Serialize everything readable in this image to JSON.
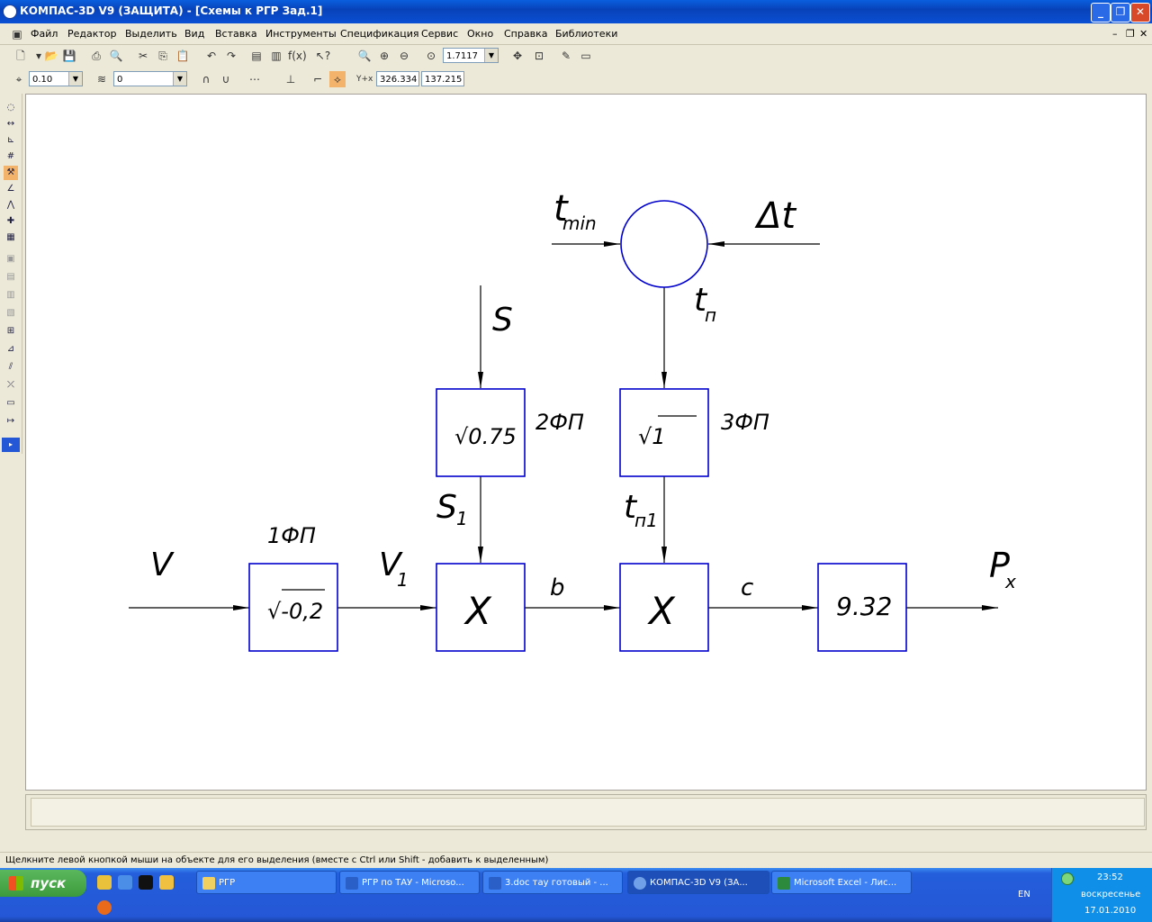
{
  "window": {
    "title": "КОМПАС-3D V9 (ЗАЩИТА) - [Схемы к РГР Зад.1]"
  },
  "menu": [
    "Файл",
    "Редактор",
    "Выделить",
    "Вид",
    "Вставка",
    "Инструменты",
    "Спецификация",
    "Сервис",
    "Окно",
    "Справка",
    "Библиотеки"
  ],
  "toolbar": {
    "zoom": "1.7117",
    "step": "0.10",
    "layer": "0",
    "coord_x": "326.334",
    "coord_y": "137.215",
    "coord_label": "Y+x"
  },
  "diagram": {
    "blocks": [
      {
        "id": "b1",
        "text": "√-0,2",
        "label": "1ФП"
      },
      {
        "id": "b2",
        "text": "√0.75",
        "label": "2ФП"
      },
      {
        "id": "b3",
        "text": "√1",
        "label": "3ФП"
      },
      {
        "id": "m1",
        "text": "X"
      },
      {
        "id": "m2",
        "text": "X"
      },
      {
        "id": "k",
        "text": "9.32"
      }
    ],
    "signals": {
      "V": "V",
      "V1": "V",
      "V1_sub": "1",
      "S": "S",
      "S1": "S",
      "S1_sub": "1",
      "tmin": "t",
      "tmin_sub": "min",
      "dt": "Δt",
      "tn": "t",
      "tn_sub": "п",
      "tn1": "t",
      "tn1_sub": "п1",
      "b": "b",
      "c": "c",
      "Px": "P",
      "Px_sub": "x"
    }
  },
  "status": {
    "hint": "Щелкните левой кнопкой мыши на объекте для его выделения (вместе с Ctrl или Shift - добавить к выделенным)"
  },
  "taskbar": {
    "start": "пуск",
    "tasks": [
      "РГР",
      "РГР по ТАУ - Microso...",
      "3.doc тау готовый - ...",
      "КОМПАС-3D V9 (ЗА...",
      "Microsoft Excel - Лис..."
    ],
    "lang": "EN",
    "time": "23:52",
    "day": "воскресенье",
    "date": "17.01.2010"
  },
  "colors": {
    "block": "#0000cc",
    "line": "#000000"
  }
}
